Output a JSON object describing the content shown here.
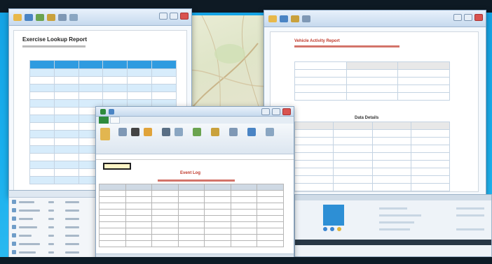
{
  "windows": {
    "left_report": {
      "title": "Exercise Lookup Report"
    },
    "right_report": {
      "title": "Vehicle Activity Report",
      "section": "Data Details"
    },
    "spreadsheet": {
      "title": "Event Log"
    }
  },
  "colors": {
    "desktop": "#1aa8e8",
    "header_blue": "#2f9be0",
    "alt_row": "#d7ecfb",
    "red_accent": "#c0392b",
    "excel_green": "#2e8b3d"
  }
}
